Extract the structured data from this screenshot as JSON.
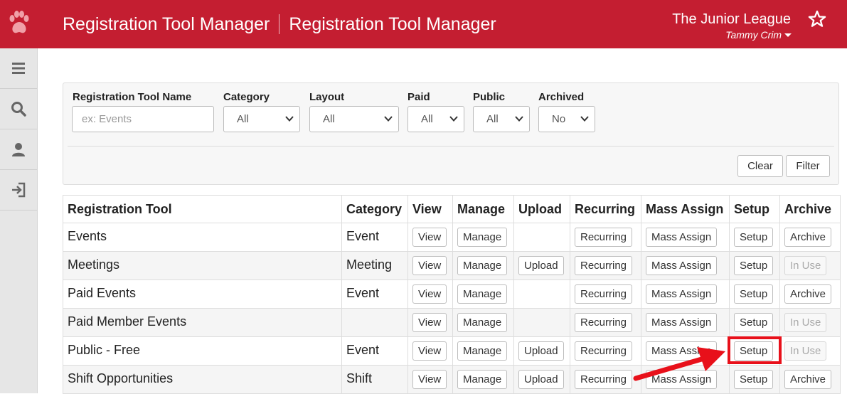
{
  "header": {
    "title_left": "Registration Tool Manager",
    "title_right": "Registration Tool Manager",
    "org_name": "The Junior League",
    "user_name": "Tammy Crim",
    "brand_color": "#c41e31",
    "logo_icon": "paw-print-icon",
    "favorite_icon": "star-icon"
  },
  "sidebar": {
    "items": [
      {
        "icon": "hamburger-menu-icon"
      },
      {
        "icon": "search-icon"
      },
      {
        "icon": "user-icon"
      },
      {
        "icon": "sign-in-icon"
      }
    ]
  },
  "filters": {
    "name_label": "Registration Tool Name",
    "name_placeholder": "ex: Events",
    "category_label": "Category",
    "category_value": "All",
    "layout_label": "Layout",
    "layout_value": "All",
    "paid_label": "Paid",
    "paid_value": "All",
    "public_label": "Public",
    "public_value": "All",
    "archived_label": "Archived",
    "archived_value": "No",
    "clear_label": "Clear",
    "filter_label": "Filter"
  },
  "table": {
    "headers": [
      "Registration Tool",
      "Category",
      "View",
      "Manage",
      "Upload",
      "Recurring",
      "Mass Assign",
      "Setup",
      "Archive"
    ],
    "rows": [
      {
        "name": "Events",
        "category": "Event",
        "view": "View",
        "manage": "Manage",
        "upload": "",
        "recurring": "Recurring",
        "mass_assign": "Mass Assign",
        "setup": "Setup",
        "archive": "Archive",
        "archive_disabled": false
      },
      {
        "name": "Meetings",
        "category": "Meeting",
        "view": "View",
        "manage": "Manage",
        "upload": "Upload",
        "recurring": "Recurring",
        "mass_assign": "Mass Assign",
        "setup": "Setup",
        "archive": "In Use",
        "archive_disabled": true
      },
      {
        "name": "Paid Events",
        "category": "Event",
        "view": "View",
        "manage": "Manage",
        "upload": "",
        "recurring": "Recurring",
        "mass_assign": "Mass Assign",
        "setup": "Setup",
        "archive": "Archive",
        "archive_disabled": false
      },
      {
        "name": "Paid Member Events",
        "category": "",
        "view": "View",
        "manage": "Manage",
        "upload": "",
        "recurring": "Recurring",
        "mass_assign": "Mass Assign",
        "setup": "Setup",
        "archive": "In Use",
        "archive_disabled": true
      },
      {
        "name": "Public - Free",
        "category": "Event",
        "view": "View",
        "manage": "Manage",
        "upload": "Upload",
        "recurring": "Recurring",
        "mass_assign": "Mass Assign",
        "setup": "Setup",
        "archive": "In Use",
        "archive_disabled": true
      },
      {
        "name": "Shift Opportunities",
        "category": "Shift",
        "view": "View",
        "manage": "Manage",
        "upload": "Upload",
        "recurring": "Recurring",
        "mass_assign": "Mass Assign",
        "setup": "Setup",
        "archive": "Archive",
        "archive_disabled": false
      }
    ]
  },
  "annotation": {
    "color": "#e8101a",
    "target": "Public - Free setup button"
  }
}
